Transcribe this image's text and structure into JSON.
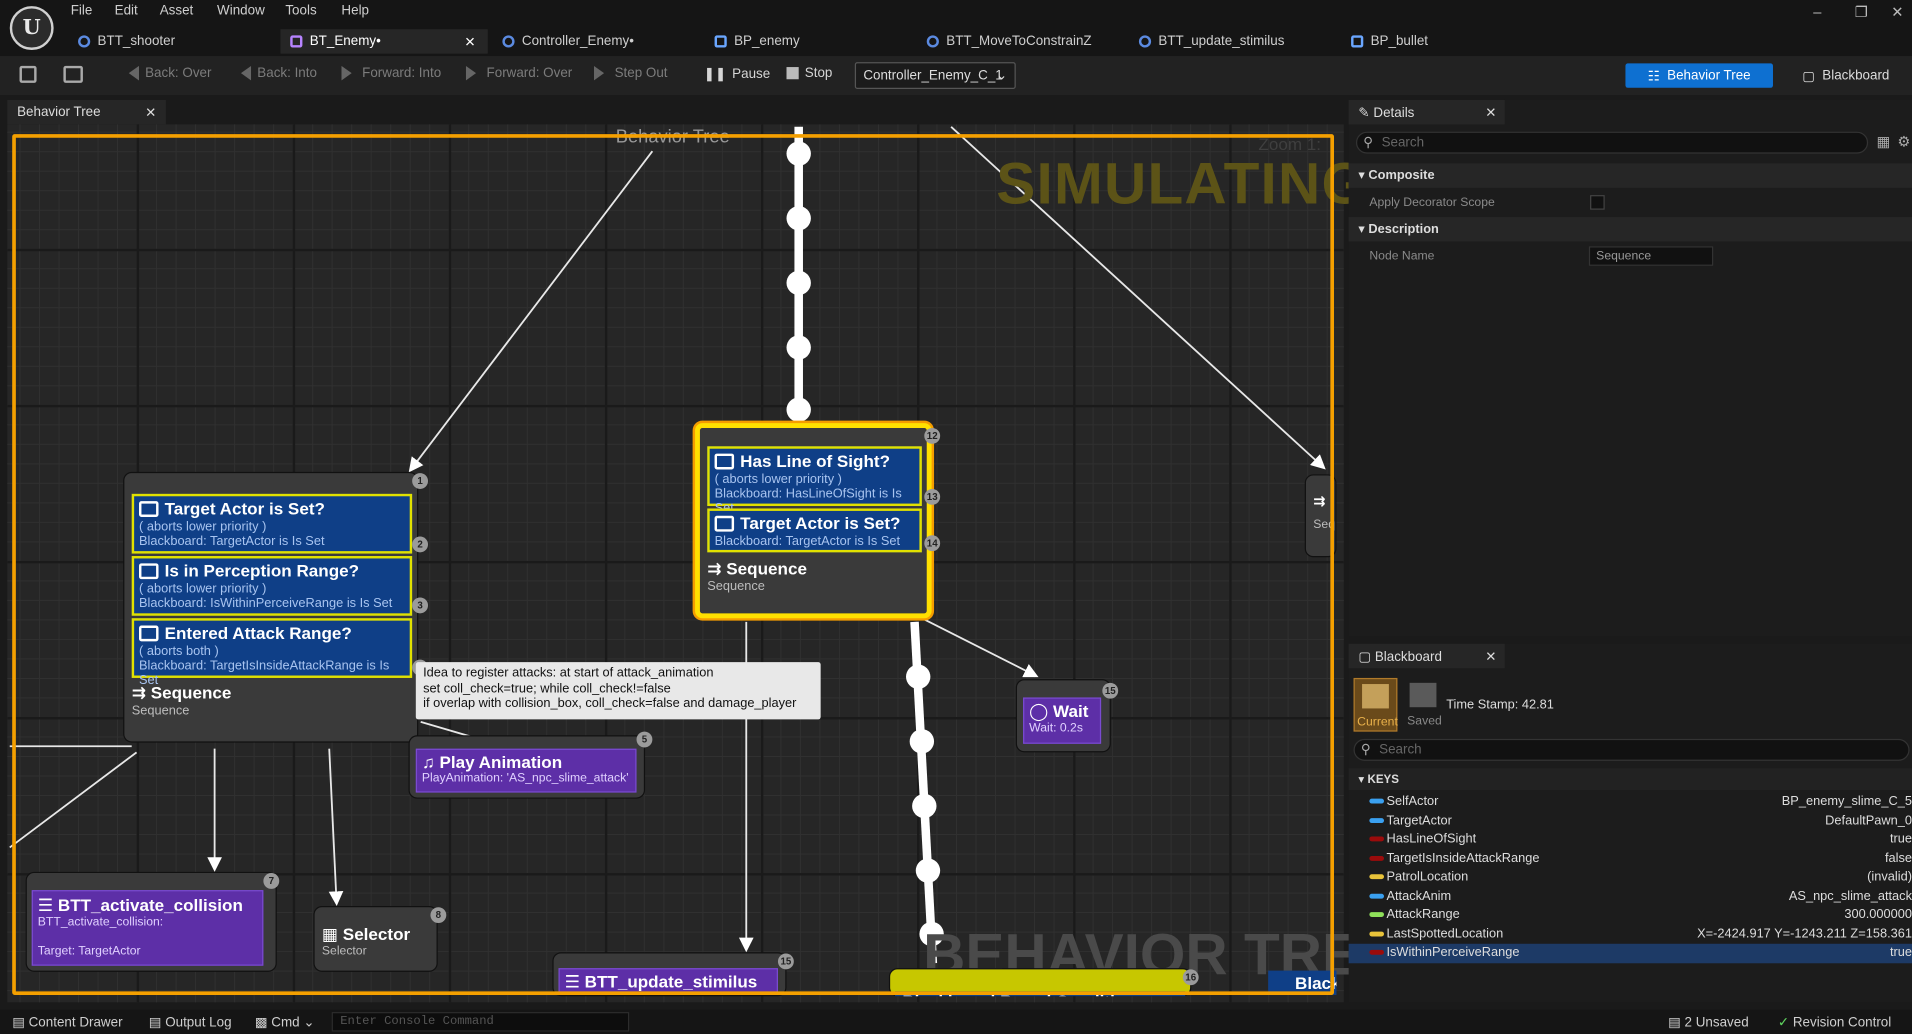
{
  "menu": [
    "File",
    "Edit",
    "Asset",
    "Window",
    "Tools",
    "Help"
  ],
  "tabs": [
    "BTT_shooter",
    "BT_Enemy•",
    "Controller_Enemy•",
    "BP_enemy",
    "BTT_MoveToConstrainZ",
    "BTT_update_stimilus",
    "BP_bullet"
  ],
  "toolbar": {
    "back_over": "Back: Over",
    "back_into": "Back: Into",
    "forward_into": "Forward: Into",
    "forward_over": "Forward: Over",
    "step_out": "Step Out",
    "pause": "Pause",
    "stop": "Stop",
    "debug_target": "Controller_Enemy_C_1",
    "behavior_tree": "Behavior Tree",
    "blackboard": "Blackboard"
  },
  "graph": {
    "tab": "Behavior Tree",
    "title": "Behavior Tree",
    "simulating": "SIMULATING",
    "zoom": "Zoom 1:",
    "watermark": "BEHAVIOR TREE",
    "left_node": {
      "decorators": [
        {
          "title": "Target Actor is Set?",
          "line1": "( aborts lower priority )",
          "line2": "Blackboard: TargetActor is Is Set",
          "badge": "2"
        },
        {
          "title": "Is in Perception Range?",
          "line1": "( aborts lower priority )",
          "line2": "Blackboard: IsWithinPerceiveRange is Is Set",
          "badge": "3"
        },
        {
          "title": "Entered Attack Range?",
          "line1": "( aborts both )",
          "line2": "Blackboard: TargetIsInsideAttackRange is Is Set",
          "badge": "4"
        }
      ],
      "title": "Sequence",
      "sub": "Sequence",
      "badge": "1"
    },
    "center_node": {
      "decorators": [
        {
          "title": "Has Line of Sight?",
          "line1": "( aborts lower priority )",
          "line2": "Blackboard: HasLineOfSight is Is Set",
          "badge": "13"
        },
        {
          "title": "Target Actor is Set?",
          "line1": "",
          "line2": "Blackboard: TargetActor is Is Set",
          "badge": "14"
        }
      ],
      "title": "Sequence",
      "sub": "Sequence",
      "badge": "12"
    },
    "comment": [
      "Idea to register attacks: at start of attack_animation",
      "set coll_check=true; while coll_check!=false",
      "if overlap with collision_box, coll_check=false and damage_player"
    ],
    "play_anim": {
      "title": "Play Animation",
      "sub": "PlayAnimation: 'AS_npc_slime_attack'",
      "badge": "5"
    },
    "wait": {
      "title": "Wait",
      "sub": "Wait: 0.2s",
      "badge": "15"
    },
    "activate": {
      "title": "BTT_activate_collision",
      "sub": "BTT_activate_collision:",
      "target": "Target: TargetActor",
      "badge": "7"
    },
    "selector": {
      "title": "Selector",
      "sub": "Selector",
      "badge": "8"
    },
    "update": {
      "title": "BTT_update_stimilus",
      "badge": "15"
    },
    "bbcond": {
      "title": "Blackboard Based Condition",
      "badge": "16"
    },
    "right_partial": {
      "sub": "Sequ"
    },
    "right_bottom_partial": {
      "title": "Black"
    }
  },
  "details": {
    "tab": "Details",
    "search": "Search",
    "composite": "Composite",
    "apply_decorator": "Apply Decorator Scope",
    "description": "Description",
    "node_name_label": "Node Name",
    "node_name_value": "Sequence"
  },
  "blackboard": {
    "tab": "Blackboard",
    "current": "Current",
    "saved": "Saved",
    "timestamp": "Time Stamp: 42.81",
    "search": "Search",
    "keys_label": "KEYS",
    "keys": [
      {
        "name": "SelfActor",
        "value": "BP_enemy_slime_C_5",
        "color": "#3aa0f0"
      },
      {
        "name": "TargetActor",
        "value": "DefaultPawn_0",
        "color": "#3aa0f0"
      },
      {
        "name": "HasLineOfSight",
        "value": "true",
        "color": "#9b0b0b"
      },
      {
        "name": "TargetIsInsideAttackRange",
        "value": "false",
        "color": "#9b0b0b"
      },
      {
        "name": "PatrolLocation",
        "value": "(invalid)",
        "color": "#e8c33a"
      },
      {
        "name": "AttackAnim",
        "value": "AS_npc_slime_attack",
        "color": "#3aa0f0"
      },
      {
        "name": "AttackRange",
        "value": "300.000000",
        "color": "#8fe05a"
      },
      {
        "name": "LastSpottedLocation",
        "value": "X=-2424.917 Y=-1243.211 Z=158.361",
        "color": "#e8c33a"
      },
      {
        "name": "IsWithinPerceiveRange",
        "value": "true",
        "color": "#9b0b0b"
      }
    ]
  },
  "status": {
    "content_drawer": "Content Drawer",
    "output_log": "Output Log",
    "cmd": "Cmd",
    "console_placeholder": "Enter Console Command",
    "unsaved": "2 Unsaved",
    "revision": "Revision Control"
  }
}
